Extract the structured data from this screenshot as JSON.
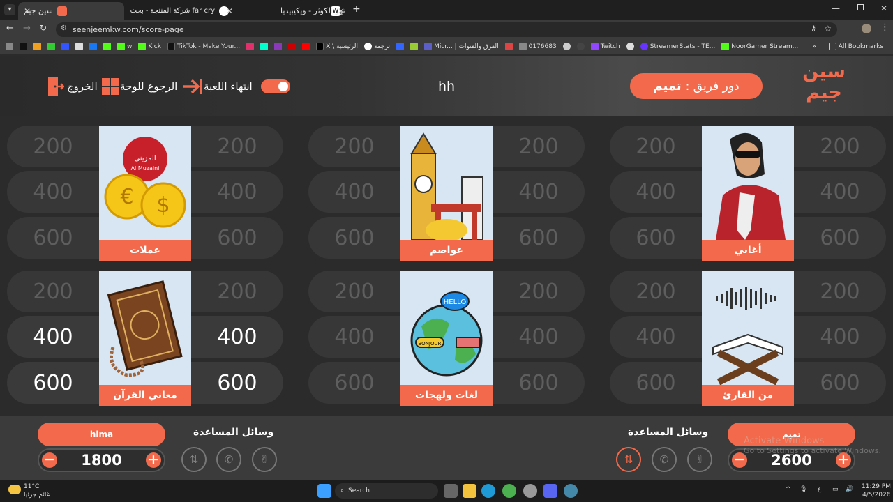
{
  "browser": {
    "tabs": [
      {
        "title": "سين جيم",
        "active": true
      },
      {
        "title": "far cry شركة المنتجة - بحث Goog"
      },
      {
        "title": "نهر الكوثر - ويكيبيديا"
      }
    ],
    "url": "seenjeemkw.com/score-page",
    "bookmarks": [
      "w",
      "Kick",
      "TikTok - Make Your...",
      "X \\ الرئيسية",
      "ترجمة",
      "Micr... | الفرق والقنوات",
      "0176683",
      "Twitch",
      "StreamerStats - TE...",
      "NoorGamer Stream...",
      "All Bookmarks"
    ]
  },
  "header": {
    "logo_line1": "سين",
    "logo_line2": "جيم",
    "turn_label": "دور فريق :",
    "turn_team": "تميم",
    "game_title": "hh",
    "end_game": "انتهاء اللعبة",
    "back_to_board": "الرجوع للوحة",
    "exit": "الخروج"
  },
  "board": {
    "values": [
      "200",
      "400",
      "600"
    ],
    "categories": [
      {
        "name": "عملات",
        "brand": "المزيني",
        "brand_en": "Al Muzaini"
      },
      {
        "name": "عواصم"
      },
      {
        "name": "أغاني"
      },
      {
        "name": "معاني القرآن"
      },
      {
        "name": "لغات ولهجات",
        "bubble1": "HELLO",
        "bubble2": "BONJOUR"
      },
      {
        "name": "من القارئ"
      }
    ],
    "active": {
      "quran_400_left": true,
      "quran_400_right": true,
      "quran_600_left": true,
      "quran_600_right": true
    }
  },
  "footer": {
    "left_team": {
      "name": "hima",
      "score": "1800"
    },
    "right_team": {
      "name": "تميم",
      "score": "2600"
    },
    "aids_label": "وسائل المساعدة",
    "minus": "−",
    "plus": "+"
  },
  "taskbar": {
    "temp": "11°C",
    "weather": "غائم جزئيا",
    "search": "Search",
    "time": "11:29 PM",
    "date": "4/5/2026",
    "lang": "ع"
  },
  "watermark": {
    "line1": "Activate Windows",
    "line2": "Go to Settings to activate Windows."
  },
  "colors": {
    "accent": "#f26a4b",
    "bg": "#2b2b2b"
  }
}
